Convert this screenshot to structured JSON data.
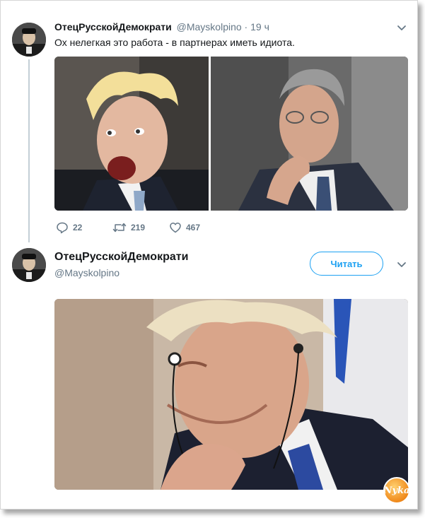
{
  "tweet1": {
    "display_name": "ОтецРусскойДемократи",
    "handle_time": "@Mayskolpino · 19 ч",
    "text": "Ох нелегкая это работа - в партнерах иметь идиота.",
    "actions": {
      "reply_count": "22",
      "retweet_count": "219",
      "like_count": "467"
    }
  },
  "tweet2": {
    "display_name": "ОтецРусскойДемократи",
    "handle": "@Mayskolpino",
    "follow_label": "Читать"
  },
  "watermark": {
    "text": "Nyka"
  },
  "colors": {
    "accent": "#1da1f2",
    "muted": "#657786",
    "name": "#14171a",
    "thread_line": "#c4cfd6"
  },
  "icons": [
    "reply-icon",
    "retweet-icon",
    "like-icon",
    "chevron-down-icon"
  ]
}
